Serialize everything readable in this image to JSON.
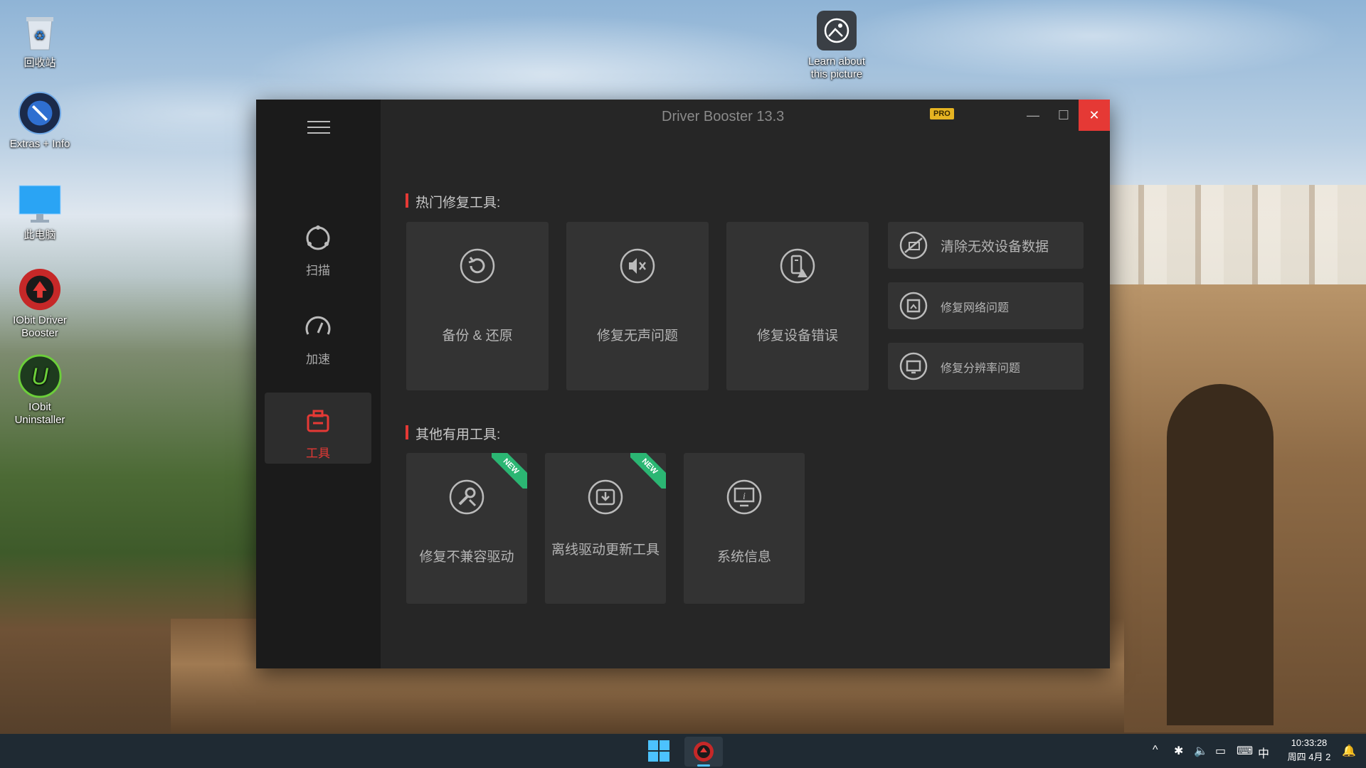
{
  "desktop": {
    "icons": [
      {
        "label": "回收站"
      },
      {
        "label": "Extras + Info"
      },
      {
        "label": "此电脑"
      },
      {
        "label": "IObit Driver Booster"
      },
      {
        "label": "IObit Uninstaller"
      }
    ],
    "learn": {
      "label_line1": "Learn about",
      "label_line2": "this picture"
    }
  },
  "app": {
    "title": "Driver Booster 13.3",
    "badge": "PRO",
    "nav": [
      {
        "label": "扫描",
        "icon": "scan-icon"
      },
      {
        "label": "加速",
        "icon": "speedometer-icon"
      },
      {
        "label": "工具",
        "icon": "toolbox-icon",
        "active": true
      }
    ],
    "hot_section": "热门修复工具:",
    "hot_tools": [
      {
        "label": "备份 & 还原",
        "icon": "backup-restore-icon"
      },
      {
        "label": "修复无声问题",
        "icon": "mute-speaker-icon"
      },
      {
        "label": "修复设备错误",
        "icon": "device-warning-icon"
      }
    ],
    "side_tools": [
      {
        "label": "清除无效设备数据",
        "icon": "clean-device-icon"
      },
      {
        "label": "修复网络问题",
        "icon": "network-icon"
      },
      {
        "label": "修复分辨率问题",
        "icon": "resolution-icon"
      }
    ],
    "other_section": "其他有用工具:",
    "other_tools": [
      {
        "label": "修复不兼容驱动",
        "icon": "wrench-icon",
        "ribbon": "NEW"
      },
      {
        "label": "离线驱动更新工具",
        "icon": "offline-drive-icon",
        "ribbon": "NEW"
      },
      {
        "label": "系统信息",
        "icon": "system-info-icon"
      }
    ],
    "accent": "#e53935",
    "new_color": "#2bb673"
  },
  "taskbar": {
    "time": "10:33:28",
    "date": "周四 4月 2",
    "ime": "中"
  }
}
